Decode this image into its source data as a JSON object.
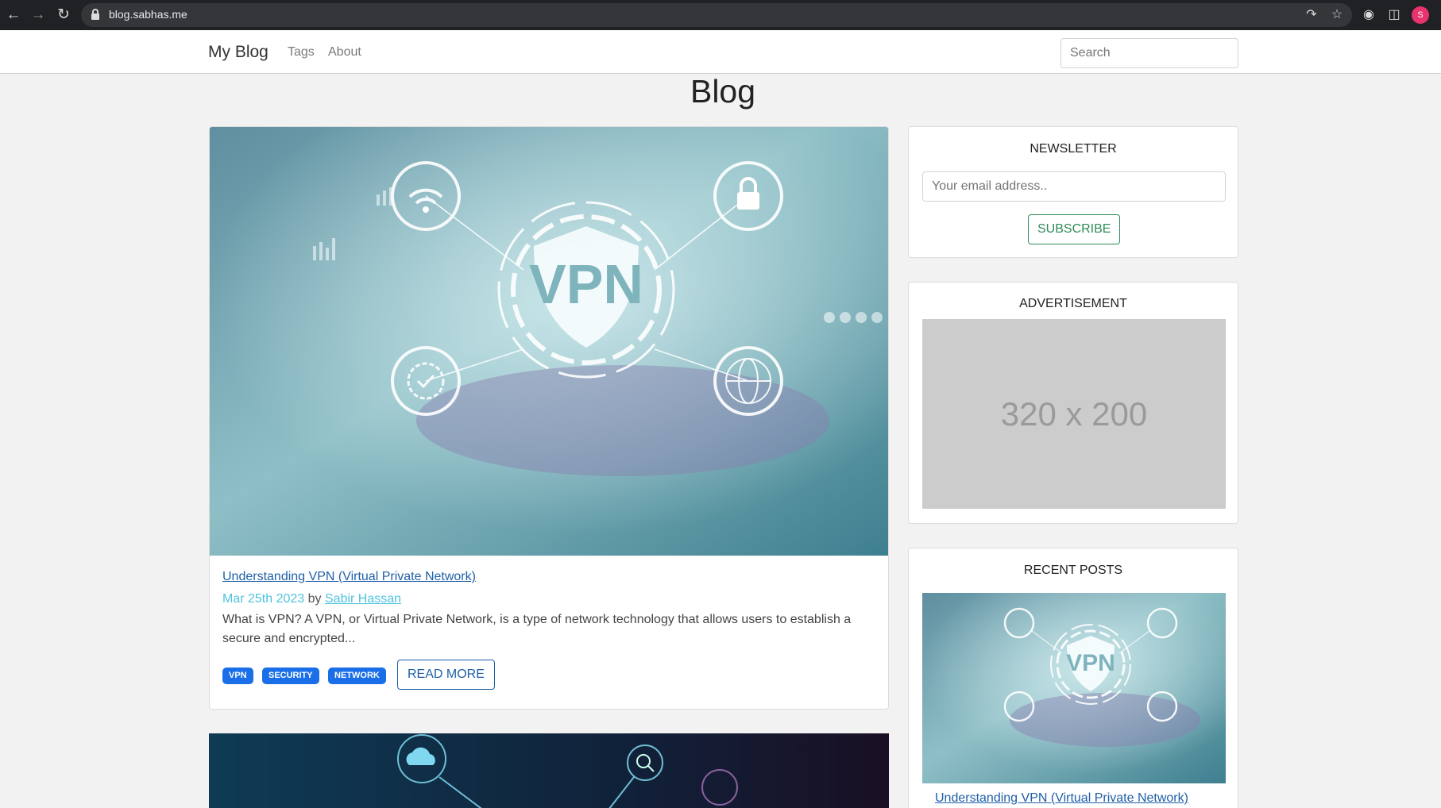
{
  "browser": {
    "url": "blog.sabhas.me",
    "avatar_letter": "S",
    "icons": [
      "back-icon",
      "forward-icon",
      "reload-icon",
      "lock-icon",
      "share-icon",
      "star-icon",
      "extensions-icon",
      "sidepanel-icon"
    ]
  },
  "navbar": {
    "brand": "My Blog",
    "links": [
      "Tags",
      "About"
    ],
    "search_placeholder": "Search"
  },
  "page": {
    "title": "Blog"
  },
  "posts": [
    {
      "title": "Understanding VPN (Virtual Private Network)",
      "date": "Mar 25th 2023",
      "by": "by",
      "author": "Sabir Hassan",
      "excerpt": "What is VPN? A VPN, or Virtual Private Network, is a type of network technology that allows users to establish a secure and encrypted...",
      "tags": [
        "VPN",
        "SECURITY",
        "NETWORK"
      ],
      "read_more": "READ MORE",
      "image_text": "VPN"
    }
  ],
  "sidebar": {
    "newsletter": {
      "title": "NEWSLETTER",
      "email_placeholder": "Your email address..",
      "button": "SUBSCRIBE"
    },
    "advertisement": {
      "title": "ADVERTISEMENT",
      "placeholder_text": "320 x 200"
    },
    "recent_posts": {
      "title": "RECENT POSTS",
      "items": [
        {
          "title": "Understanding VPN (Virtual Private Network)",
          "image_text": "VPN"
        }
      ]
    }
  },
  "colors": {
    "tag_bg": "#1a6fe8",
    "link": "#1f5fa8",
    "date": "#4fc3e0",
    "subscribe": "#2e8b57",
    "page_bg": "#f2f2f2"
  }
}
